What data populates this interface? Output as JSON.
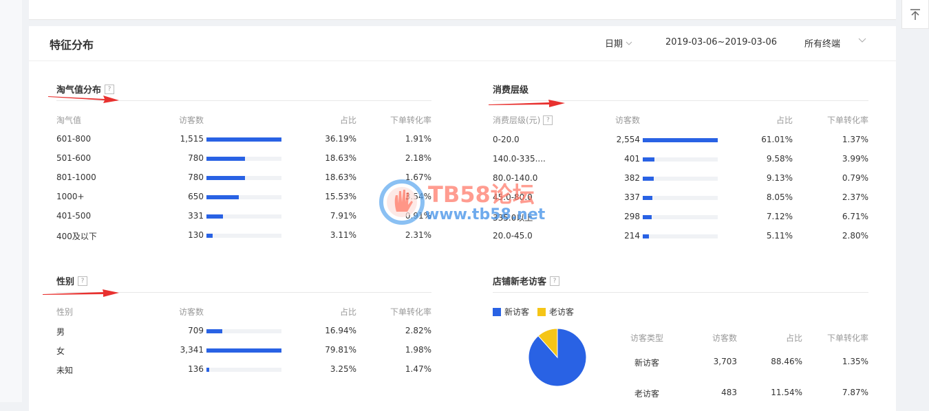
{
  "header": {
    "title": "特征分布",
    "date_label": "日期",
    "date_range": "2019-03-06~2019-03-06",
    "terminal": "所有终端"
  },
  "colors": {
    "bar": "#2962e4",
    "new_visitor": "#2962e4",
    "old_visitor": "#f5c517",
    "arrow": "#e8312f"
  },
  "taoqi": {
    "title": "淘气值分布",
    "headers": [
      "淘气值",
      "访客数",
      "占比",
      "下单转化率"
    ],
    "rows": [
      {
        "label": "601-800",
        "visitors": "1,515",
        "share": "36.19%",
        "conv": "1.91%",
        "ratio": 1.0
      },
      {
        "label": "501-600",
        "visitors": "780",
        "share": "18.63%",
        "conv": "2.18%",
        "ratio": 0.515
      },
      {
        "label": "801-1000",
        "visitors": "780",
        "share": "18.63%",
        "conv": "1.67%",
        "ratio": 0.515
      },
      {
        "label": "1000+",
        "visitors": "650",
        "share": "15.53%",
        "conv": "3.54%",
        "ratio": 0.429
      },
      {
        "label": "401-500",
        "visitors": "331",
        "share": "7.91%",
        "conv": "0.91%",
        "ratio": 0.218
      },
      {
        "label": "400及以下",
        "visitors": "130",
        "share": "3.11%",
        "conv": "2.31%",
        "ratio": 0.086
      }
    ]
  },
  "spend": {
    "title": "消费层级",
    "headers": [
      "消费层级(元)",
      "访客数",
      "占比",
      "下单转化率"
    ],
    "rows": [
      {
        "label": "0-20.0",
        "visitors": "2,554",
        "share": "61.01%",
        "conv": "1.37%",
        "ratio": 1.0
      },
      {
        "label": "140.0-335....",
        "visitors": "401",
        "share": "9.58%",
        "conv": "3.99%",
        "ratio": 0.157
      },
      {
        "label": "80.0-140.0",
        "visitors": "382",
        "share": "9.13%",
        "conv": "0.79%",
        "ratio": 0.15
      },
      {
        "label": "45.0-80.0",
        "visitors": "337",
        "share": "8.05%",
        "conv": "2.37%",
        "ratio": 0.132
      },
      {
        "label": "335.0以上",
        "visitors": "298",
        "share": "7.12%",
        "conv": "6.71%",
        "ratio": 0.117
      },
      {
        "label": "20.0-45.0",
        "visitors": "214",
        "share": "5.11%",
        "conv": "2.80%",
        "ratio": 0.084
      }
    ]
  },
  "gender": {
    "title": "性别",
    "headers": [
      "性别",
      "访客数",
      "占比",
      "下单转化率"
    ],
    "rows": [
      {
        "label": "男",
        "visitors": "709",
        "share": "16.94%",
        "conv": "2.82%",
        "ratio": 0.212
      },
      {
        "label": "女",
        "visitors": "3,341",
        "share": "79.81%",
        "conv": "1.98%",
        "ratio": 1.0
      },
      {
        "label": "未知",
        "visitors": "136",
        "share": "3.25%",
        "conv": "1.47%",
        "ratio": 0.041
      }
    ]
  },
  "shop": {
    "title": "店铺新老访客",
    "legend": [
      "新访客",
      "老访客"
    ],
    "headers": [
      "访客类型",
      "访客数",
      "占比",
      "下单转化率"
    ],
    "rows": [
      {
        "label": "新访客",
        "visitors": "3,703",
        "share": "88.46%",
        "conv": "1.35%"
      },
      {
        "label": "老访客",
        "visitors": "483",
        "share": "11.54%",
        "conv": "7.87%"
      }
    ]
  },
  "chart_data": {
    "type": "pie",
    "categories": [
      "新访客",
      "老访客"
    ],
    "values": [
      88.46,
      11.54
    ],
    "colors": [
      "#2962e4",
      "#f5c517"
    ]
  },
  "watermark": {
    "line1": "TB58论坛",
    "line2": "www.tb58.net"
  }
}
